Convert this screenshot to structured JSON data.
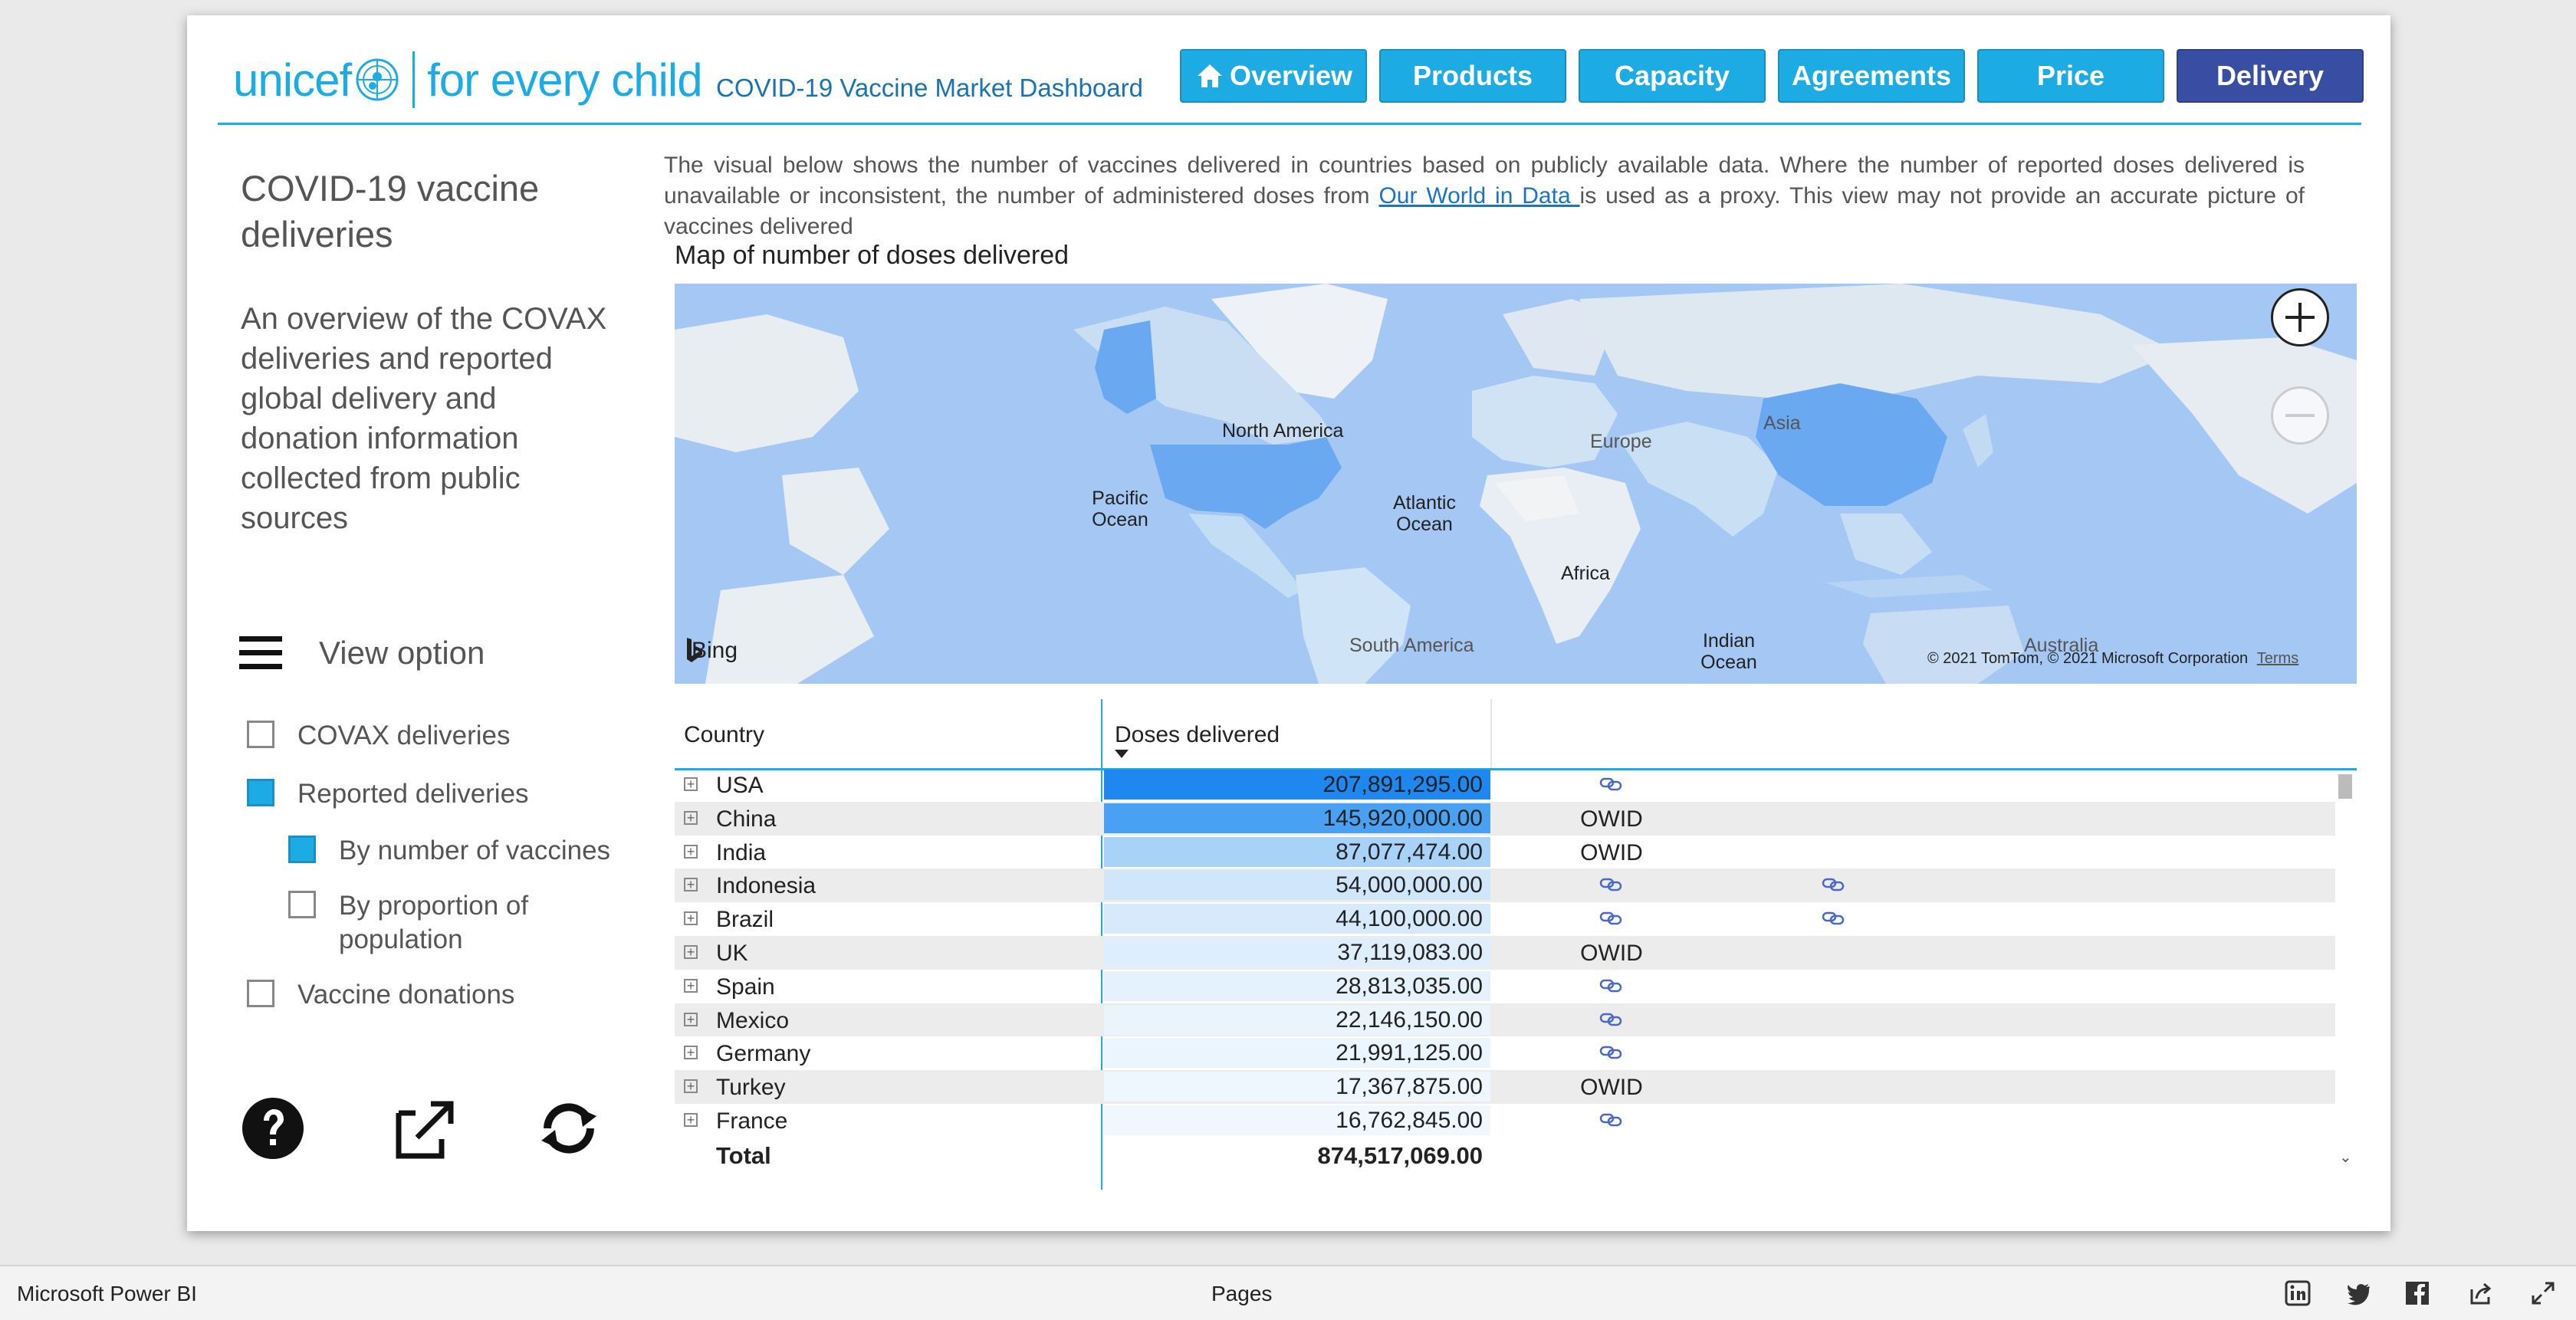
{
  "header": {
    "brand": "unicef",
    "tagline": "for every child",
    "dashboard_title": "COVID-19 Vaccine Market Dashboard",
    "nav": [
      {
        "label": "Overview",
        "active": false
      },
      {
        "label": "Products",
        "active": false
      },
      {
        "label": "Capacity",
        "active": false
      },
      {
        "label": "Agreements",
        "active": false
      },
      {
        "label": "Price",
        "active": false
      },
      {
        "label": "Delivery",
        "active": true
      }
    ]
  },
  "sidebar": {
    "title": "COVID-19 vaccine deliveries",
    "description": "An overview of the COVAX deliveries and reported global delivery and donation information collected from public sources",
    "view_option_label": "View option",
    "options": [
      {
        "label": "COVAX deliveries",
        "checked": false
      },
      {
        "label": "Reported deliveries",
        "checked": true
      },
      {
        "label": "By number of vaccines",
        "checked": true
      },
      {
        "label": "By proportion of population",
        "checked": false
      },
      {
        "label": "Vaccine donations",
        "checked": false
      }
    ],
    "footer_icons": [
      "help-icon",
      "open-external-icon",
      "refresh-icon"
    ]
  },
  "intro": {
    "text_before": "The visual below shows the number of vaccines delivered in countries based on publicly available data. Where the number of reported doses delivered is unavailable or inconsistent, the number of administered doses from ",
    "link_text": "Our World in Data ",
    "text_after": "is used as a proxy. This view may not provide an accurate picture of vaccines delivered"
  },
  "map": {
    "title": "Map of number of doses delivered",
    "labels": {
      "north_america": "North America",
      "europe": "Europe",
      "asia": "Asia",
      "pacific_ocean": "Pacific Ocean",
      "atlantic_ocean": "Atlantic Ocean",
      "africa": "Africa",
      "south_america": "South America",
      "indian_ocean": "Indian Ocean",
      "australia": "Australia"
    },
    "provider": "Bing",
    "copyright": "© 2021 TomTom, © 2021 Microsoft Corporation",
    "terms": "Terms"
  },
  "table": {
    "columns": [
      "Country",
      "Doses delivered"
    ],
    "rows": [
      {
        "country": "USA",
        "doses": "207,891,295.00",
        "source": "",
        "links": 1
      },
      {
        "country": "China",
        "doses": "145,920,000.00",
        "source": "OWID",
        "links": 0
      },
      {
        "country": "India",
        "doses": "87,077,474.00",
        "source": "OWID",
        "links": 0
      },
      {
        "country": "Indonesia",
        "doses": "54,000,000.00",
        "source": "",
        "links": 2
      },
      {
        "country": "Brazil",
        "doses": "44,100,000.00",
        "source": "",
        "links": 2
      },
      {
        "country": "UK",
        "doses": "37,119,083.00",
        "source": "OWID",
        "links": 0
      },
      {
        "country": "Spain",
        "doses": "28,813,035.00",
        "source": "",
        "links": 1
      },
      {
        "country": "Mexico",
        "doses": "22,146,150.00",
        "source": "",
        "links": 1
      },
      {
        "country": "Germany",
        "doses": "21,991,125.00",
        "source": "",
        "links": 1
      },
      {
        "country": "Turkey",
        "doses": "17,367,875.00",
        "source": "OWID",
        "links": 0
      },
      {
        "country": "France",
        "doses": "16,762,845.00",
        "source": "",
        "links": 1
      }
    ],
    "total_label": "Total",
    "total_value": "874,517,069.00",
    "bar_colors": [
      "#1e88f0",
      "#4aa0f2",
      "#a8d2f8",
      "#cfe6fb",
      "#d7eafc",
      "#deeefc",
      "#e5f2fd",
      "#e9f4fd",
      "#ebf5fe",
      "#eef6fe",
      "#f0f7fe"
    ]
  },
  "statusbar": {
    "app_name": "Microsoft Power BI",
    "pages_label": "Pages",
    "icons": [
      "linkedin-icon",
      "twitter-icon",
      "facebook-icon",
      "share-icon",
      "fullscreen-icon"
    ]
  },
  "colors": {
    "unicef_blue": "#1cabe2",
    "active_nav": "#374ea2",
    "map_water": "#a4c7f3",
    "highlight_country": "#6aa9f2"
  }
}
